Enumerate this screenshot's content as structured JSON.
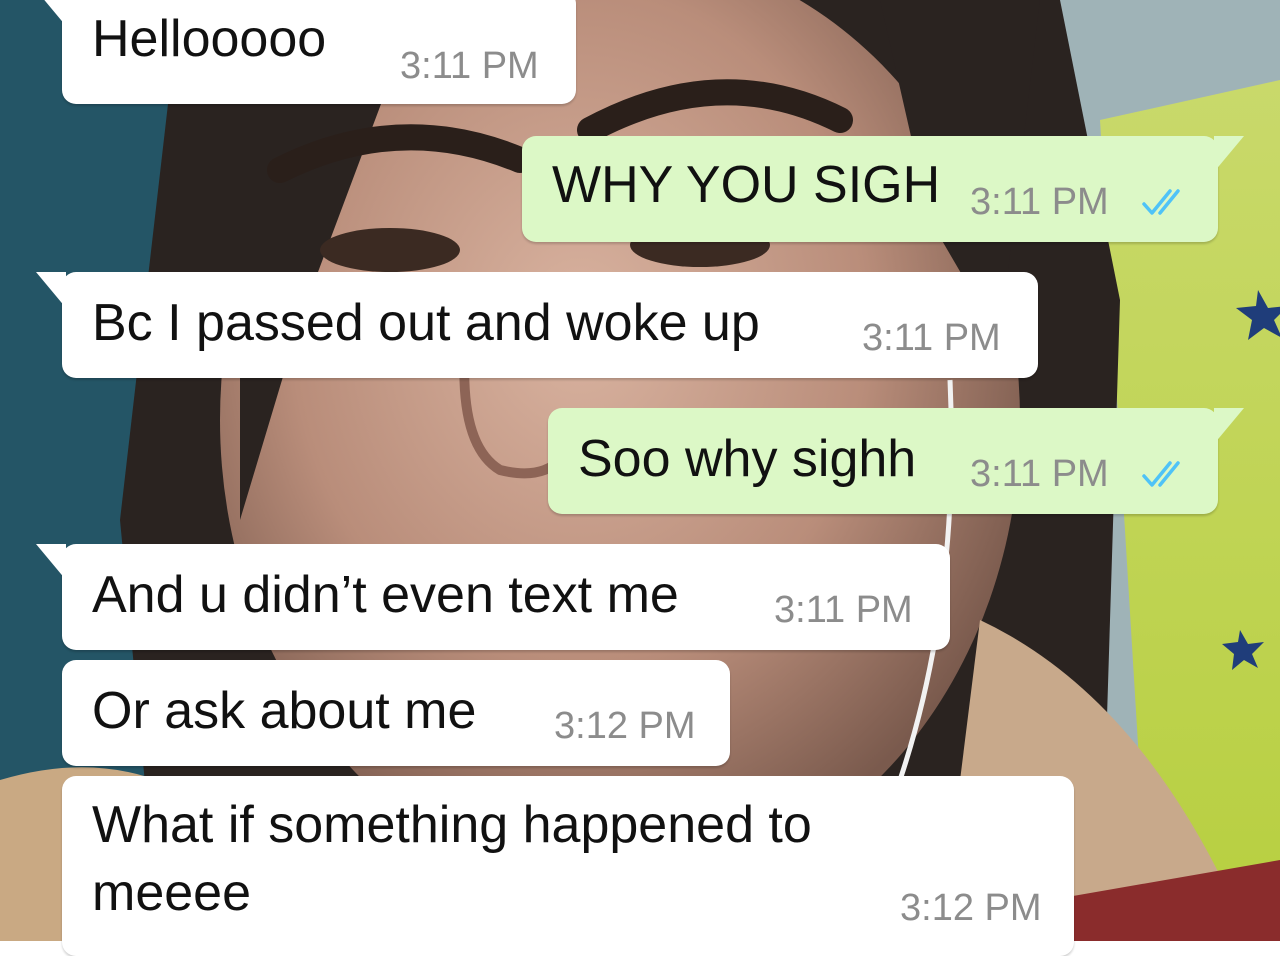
{
  "colors": {
    "incoming_bubble": "#ffffff",
    "outgoing_bubble": "#dcf8c6",
    "timestamp": "#8c8c8c",
    "read_ticks": "#4fc3f7"
  },
  "messages": [
    {
      "direction": "incoming",
      "text": "Hellooooo",
      "time": "3:11 PM"
    },
    {
      "direction": "outgoing",
      "text": "WHY YOU SIGH",
      "time": "3:11 PM",
      "status": "read"
    },
    {
      "direction": "incoming",
      "text": "Bc I passed out and woke up",
      "time": "3:11 PM"
    },
    {
      "direction": "outgoing",
      "text": "Soo why sighh",
      "time": "3:11 PM",
      "status": "read"
    },
    {
      "direction": "incoming",
      "text": "And u didn’t even text me",
      "time": "3:11 PM"
    },
    {
      "direction": "incoming",
      "text": "Or ask about me",
      "time": "3:12 PM"
    },
    {
      "direction": "incoming",
      "text_line1": "What if something happened to",
      "text_line2": "meeee",
      "time": "3:12 PM"
    }
  ],
  "icons": {
    "read_receipt": "double-check-icon"
  }
}
